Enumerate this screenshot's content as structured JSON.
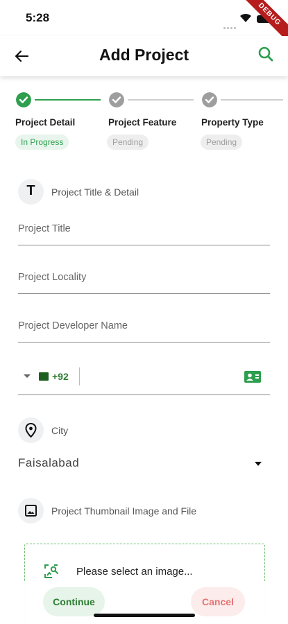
{
  "status_bar": {
    "time": "5:28",
    "debug_banner": "DEBUG"
  },
  "app_bar": {
    "title": "Add Project",
    "back_icon": "arrow-back-icon",
    "search_icon": "search-icon"
  },
  "colors": {
    "accent": "#2e9e4f",
    "pending_grey": "#9e9e9e",
    "cancel_red": "#e57373"
  },
  "stepper": {
    "steps": [
      {
        "label": "Project Detail",
        "status": "In Progress"
      },
      {
        "label": "Project Feature",
        "status": "Pending"
      },
      {
        "label": "Property Type",
        "status": "Pending"
      }
    ]
  },
  "form": {
    "title_section": {
      "icon_letter": "T",
      "label": "Project Title & Detail"
    },
    "fields": {
      "project_title": {
        "placeholder": "Project Title"
      },
      "project_locality": {
        "placeholder": "Project Locality"
      },
      "developer_name": {
        "placeholder": "Project Developer Name"
      }
    },
    "phone": {
      "dial_code": "+92",
      "country": "pakistan-flag-icon"
    },
    "city_section": {
      "label": "City",
      "value": "Faisalabad"
    },
    "thumbnail_section": {
      "label": "Project Thumbnail Image and File",
      "upload_prompt": "Please select an image..."
    }
  },
  "footer": {
    "continue_label": "Continue",
    "cancel_label": "Cancel"
  }
}
